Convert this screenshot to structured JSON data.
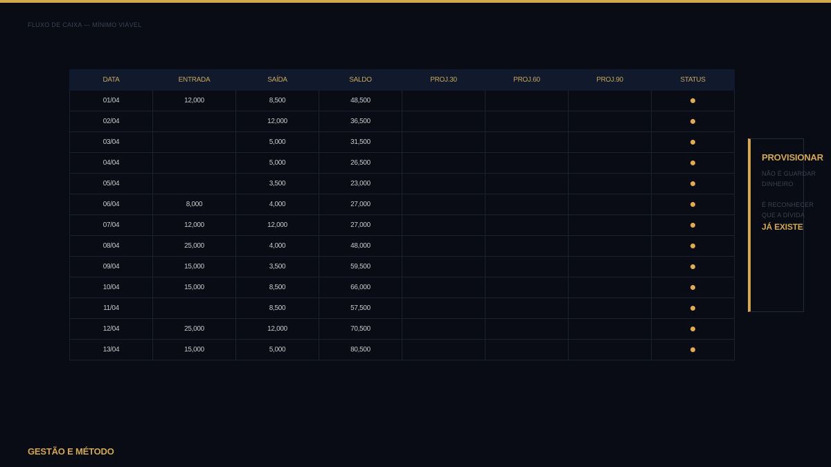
{
  "header": {
    "kicker": "FLUXO DE CAIXA — MÍNIMO VIÁVEL"
  },
  "table": {
    "columns": [
      "DATA",
      "ENTRADA",
      "SAÍDA",
      "SALDO",
      "PROJ.30",
      "PROJ.60",
      "PROJ.90",
      "STATUS"
    ],
    "rows": [
      {
        "data": "01/04",
        "entrada": "12,000",
        "saida": "8,500",
        "saldo": "48,500",
        "status": "ok"
      },
      {
        "data": "02/04",
        "entrada": "",
        "saida": "12,000",
        "saldo": "36,500",
        "status": "ok"
      },
      {
        "data": "03/04",
        "entrada": "",
        "saida": "5,000",
        "saldo": "31,500",
        "status": "ok"
      },
      {
        "data": "04/04",
        "entrada": "",
        "saida": "5,000",
        "saldo": "26,500",
        "status": "ok"
      },
      {
        "data": "05/04",
        "entrada": "",
        "saida": "3,500",
        "saldo": "23,000",
        "status": "ok"
      },
      {
        "data": "06/04",
        "entrada": "8,000",
        "saida": "4,000",
        "saldo": "27,000",
        "status": "ok"
      },
      {
        "data": "07/04",
        "entrada": "12,000",
        "saida": "12,000",
        "saldo": "27,000",
        "status": "ok"
      },
      {
        "data": "08/04",
        "entrada": "25,000",
        "saida": "4,000",
        "saldo": "48,000",
        "status": "ok"
      },
      {
        "data": "09/04",
        "entrada": "15,000",
        "saida": "3,500",
        "saldo": "59,500",
        "status": "ok"
      },
      {
        "data": "10/04",
        "entrada": "15,000",
        "saida": "8,500",
        "saldo": "66,000",
        "status": "ok"
      },
      {
        "data": "11/04",
        "entrada": "",
        "saida": "8,500",
        "saldo": "57,500",
        "status": "ok"
      },
      {
        "data": "12/04",
        "entrada": "25,000",
        "saida": "12,000",
        "saldo": "70,500",
        "status": "ok"
      },
      {
        "data": "13/04",
        "entrada": "15,000",
        "saida": "5,000",
        "saldo": "80,500",
        "status": "ok"
      }
    ]
  },
  "callout": {
    "title": "PROVISIONAR",
    "line1": "NÃO É GUARDAR",
    "line2": "DINHEIRO",
    "line3": "É RECONHECER",
    "line4": "QUE A DÍVIDA",
    "accent": "JÁ EXISTE"
  },
  "footer": {
    "brand": "GESTÃO E MÉTODO"
  },
  "colors": {
    "background": "#090c14",
    "accent": "#d4a84c",
    "entrada": "#2f8a4a",
    "saida": "#8a2e2a",
    "status_dot": "#e2ac4e",
    "header_fill": "#111a2c"
  },
  "icons": {
    "status": "status-dot-icon"
  }
}
